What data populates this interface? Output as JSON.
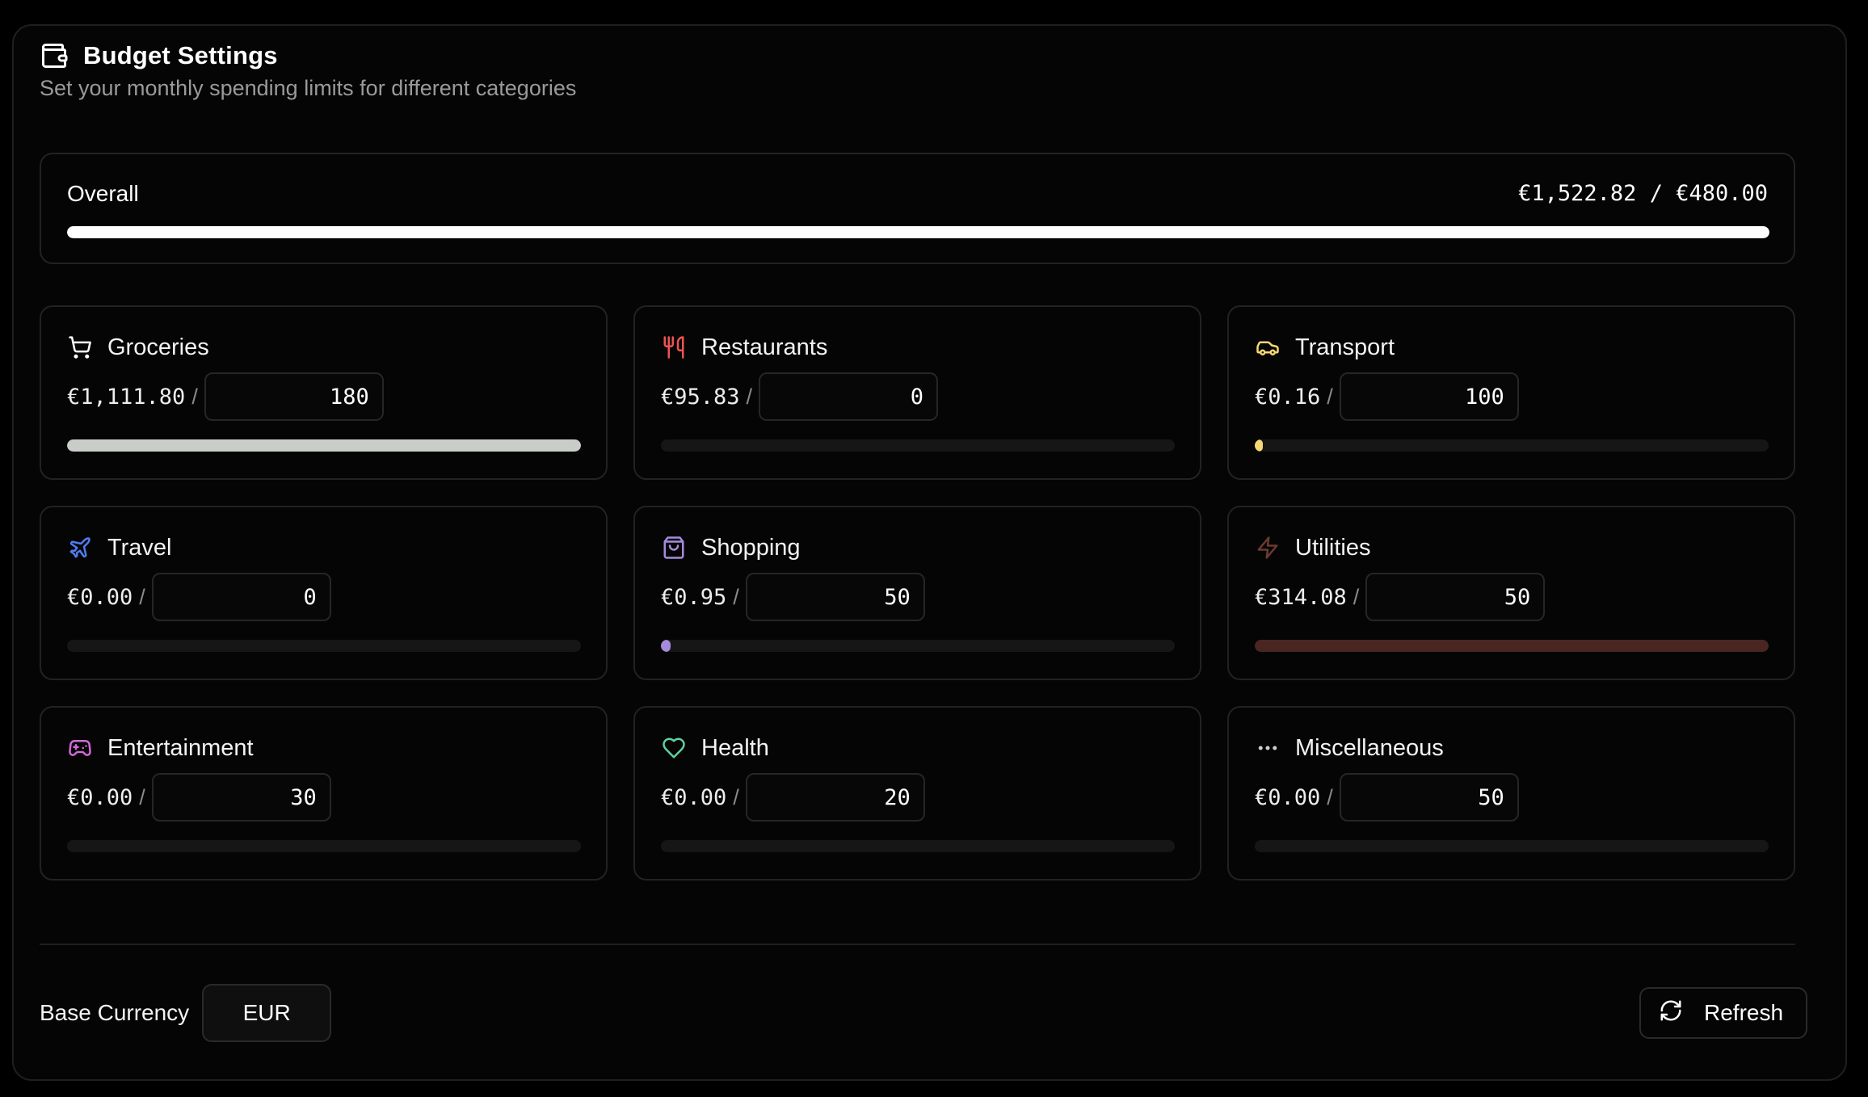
{
  "header": {
    "title": "Budget Settings",
    "subtitle": "Set your monthly spending limits for different categories",
    "icon": "wallet-icon"
  },
  "overall": {
    "label": "Overall",
    "amount": "€1,522.82 / €480.00",
    "progress": 1.0,
    "color": "#ffffff"
  },
  "categories": [
    {
      "name": "Groceries",
      "icon": "shopping-cart-icon",
      "spent": "€1,111.80",
      "limit": "180",
      "progress": 1.0,
      "color": "#c8cdc8",
      "icon_color": "#ffffff"
    },
    {
      "name": "Restaurants",
      "icon": "utensils-icon",
      "spent": "€95.83",
      "limit": "0",
      "progress": 0,
      "color": "#ef4444",
      "icon_color": "#f05252"
    },
    {
      "name": "Transport",
      "icon": "car-icon",
      "spent": "€0.16",
      "limit": "100",
      "progress": 0.0016,
      "color": "#f5d774",
      "icon_color": "#f5d774"
    },
    {
      "name": "Travel",
      "icon": "plane-icon",
      "spent": "€0.00",
      "limit": "0",
      "progress": 0,
      "color": "#4f7cf0",
      "icon_color": "#4f7cf0"
    },
    {
      "name": "Shopping",
      "icon": "shopping-bag-icon",
      "spent": "€0.95",
      "limit": "50",
      "progress": 0.019,
      "color": "#a78bdb",
      "icon_color": "#a78bdb"
    },
    {
      "name": "Utilities",
      "icon": "zap-icon",
      "spent": "€314.08",
      "limit": "50",
      "progress": 1.0,
      "color": "#4a2622",
      "icon_color": "#6b3a30"
    },
    {
      "name": "Entertainment",
      "icon": "gamepad-icon",
      "spent": "€0.00",
      "limit": "30",
      "progress": 0,
      "color": "#d16ad6",
      "icon_color": "#d16ad6"
    },
    {
      "name": "Health",
      "icon": "heart-icon",
      "spent": "€0.00",
      "limit": "20",
      "progress": 0,
      "color": "#5fd3a0",
      "icon_color": "#5fd3a0"
    },
    {
      "name": "Miscellaneous",
      "icon": "more-horizontal-icon",
      "spent": "€0.00",
      "limit": "50",
      "progress": 0,
      "color": "#cfcfcf",
      "icon_color": "#cfcfcf"
    }
  ],
  "separator": "/",
  "footer": {
    "currency_label": "Base Currency",
    "currency_value": "EUR",
    "refresh_label": "Refresh"
  }
}
